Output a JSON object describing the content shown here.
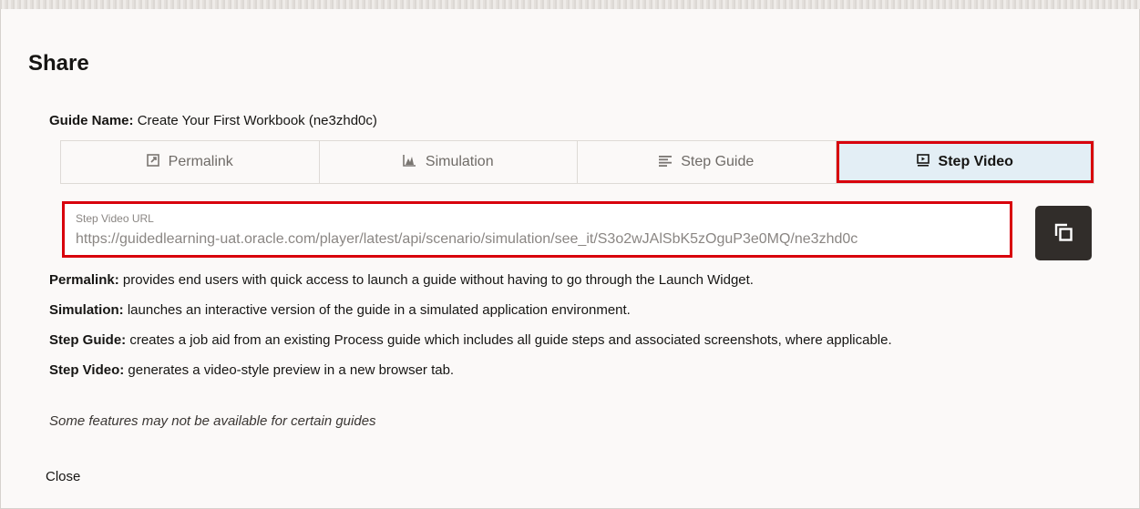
{
  "dialog": {
    "title": "Share",
    "guide_name_label": "Guide Name:",
    "guide_name_value": "Create Your First Workbook (ne3zhd0c)",
    "tabs": [
      {
        "label": "Permalink",
        "icon": "external-link-icon"
      },
      {
        "label": "Simulation",
        "icon": "chart-icon"
      },
      {
        "label": "Step Guide",
        "icon": "list-icon"
      },
      {
        "label": "Step Video",
        "icon": "video-icon",
        "active": true
      }
    ],
    "url_field": {
      "label": "Step Video URL",
      "value": "https://guidedlearning-uat.oracle.com/player/latest/api/scenario/simulation/see_it/S3o2wJAlSbK5zOguP3e0MQ/ne3zhd0c"
    },
    "descriptions": [
      {
        "term": "Permalink:",
        "text": " provides end users with quick access to launch a guide without having to go through the Launch Widget."
      },
      {
        "term": "Simulation:",
        "text": " launches an interactive version of the guide in a simulated application environment."
      },
      {
        "term": "Step Guide:",
        "text": " creates a job aid from an existing Process guide which includes all guide steps and associated screenshots, where applicable."
      },
      {
        "term": "Step Video:",
        "text": " generates a video-style preview in a new browser tab."
      }
    ],
    "note": "Some features may not be available for certain guides",
    "close_label": "Close",
    "highlight_color": "#d8000c"
  }
}
